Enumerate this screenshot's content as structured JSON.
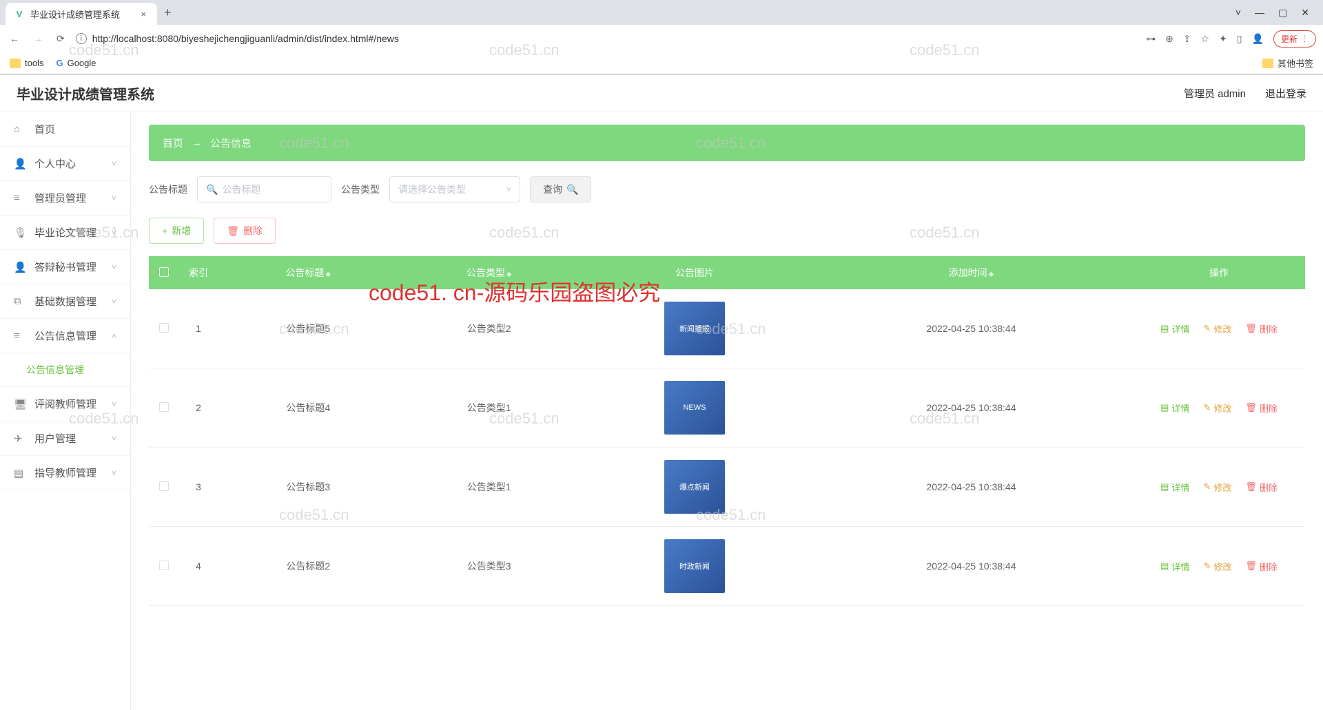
{
  "browser": {
    "tab_title": "毕业设计成绩管理系统",
    "url": "http://localhost:8080/biyeshejichengjiguanli/admin/dist/index.html#/news",
    "new_tab": "+",
    "update_btn": "更新",
    "bookmarks": {
      "tools": "tools",
      "google": "Google",
      "other": "其他书签"
    }
  },
  "header": {
    "title": "毕业设计成绩管理系统",
    "user": "管理员 admin",
    "logout": "退出登录"
  },
  "sidebar": {
    "home": "首页",
    "personal": "个人中心",
    "admin_mgmt": "管理员管理",
    "thesis_mgmt": "毕业论文管理",
    "defense_mgmt": "答辩秘书管理",
    "basedata_mgmt": "基础数据管理",
    "notice_mgmt": "公告信息管理",
    "notice_sub": "公告信息管理",
    "review_mgmt": "评阅教师管理",
    "user_mgmt": "用户管理",
    "advisor_mgmt": "指导教师管理"
  },
  "breadcrumb": {
    "home": "首页",
    "arrow": "→",
    "current": "公告信息"
  },
  "filter": {
    "title_label": "公告标题",
    "title_placeholder": "公告标题",
    "type_label": "公告类型",
    "type_placeholder": "请选择公告类型",
    "query_btn": "查询"
  },
  "tools": {
    "add": "新增",
    "delete": "删除"
  },
  "table": {
    "headers": {
      "index": "索引",
      "title": "公告标题",
      "type": "公告类型",
      "image": "公告图片",
      "time": "添加时间",
      "ops": "操作"
    },
    "ops": {
      "detail": "详情",
      "edit": "修改",
      "delete": "删除"
    },
    "rows": [
      {
        "idx": "1",
        "title": "公告标题5",
        "type": "公告类型2",
        "img_label": "新闻播报",
        "time": "2022-04-25 10:38:44"
      },
      {
        "idx": "2",
        "title": "公告标题4",
        "type": "公告类型1",
        "img_label": "NEWS",
        "time": "2022-04-25 10:38:44"
      },
      {
        "idx": "3",
        "title": "公告标题3",
        "type": "公告类型1",
        "img_label": "爆点新闻",
        "time": "2022-04-25 10:38:44"
      },
      {
        "idx": "4",
        "title": "公告标题2",
        "type": "公告类型3",
        "img_label": "时政新闻",
        "time": "2022-04-25 10:38:44"
      }
    ]
  },
  "watermarks": {
    "text": "code51.cn",
    "red": "code51. cn-源码乐园盗图必究"
  }
}
